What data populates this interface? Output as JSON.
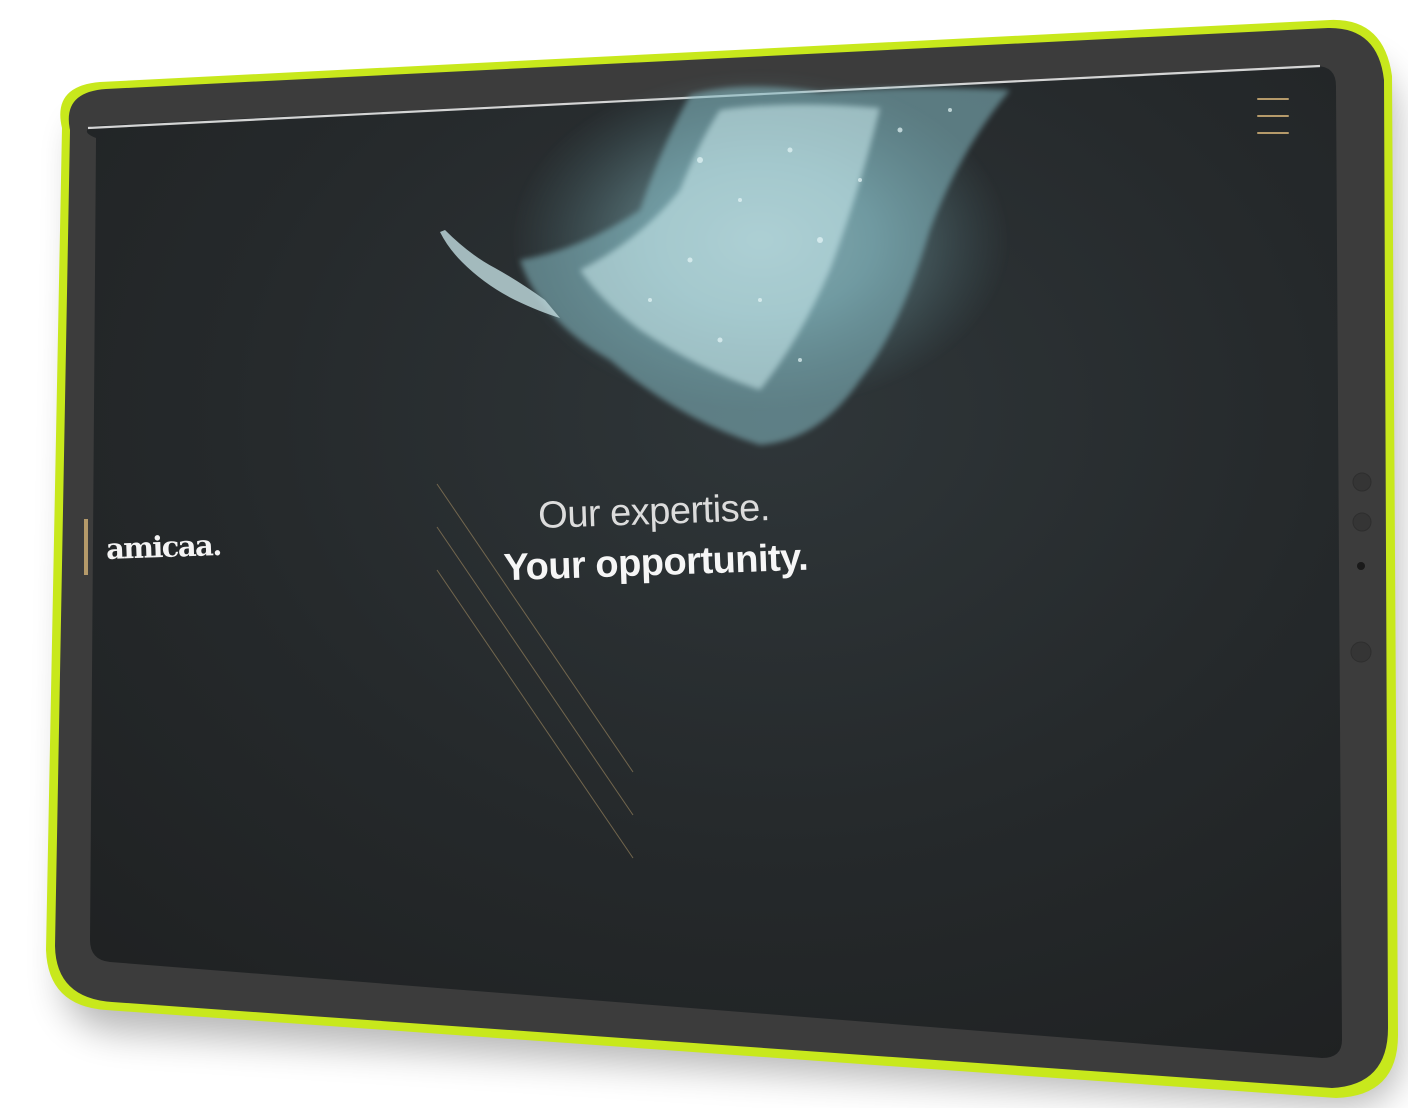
{
  "hero": {
    "line1": "Our expertise.",
    "line2": "Your opportunity."
  },
  "logo": {
    "text": "amicaa."
  },
  "menu": {
    "icon": "hamburger-menu-icon"
  },
  "colors": {
    "frame_accent": "#c8e81c",
    "device_body": "#3c3c3c",
    "screen_background": "#24282a",
    "gold_accent": "#b59a6a",
    "splash_color": "#9fcfd6"
  },
  "hero_image": {
    "icon": "water-splash-diver-image"
  }
}
